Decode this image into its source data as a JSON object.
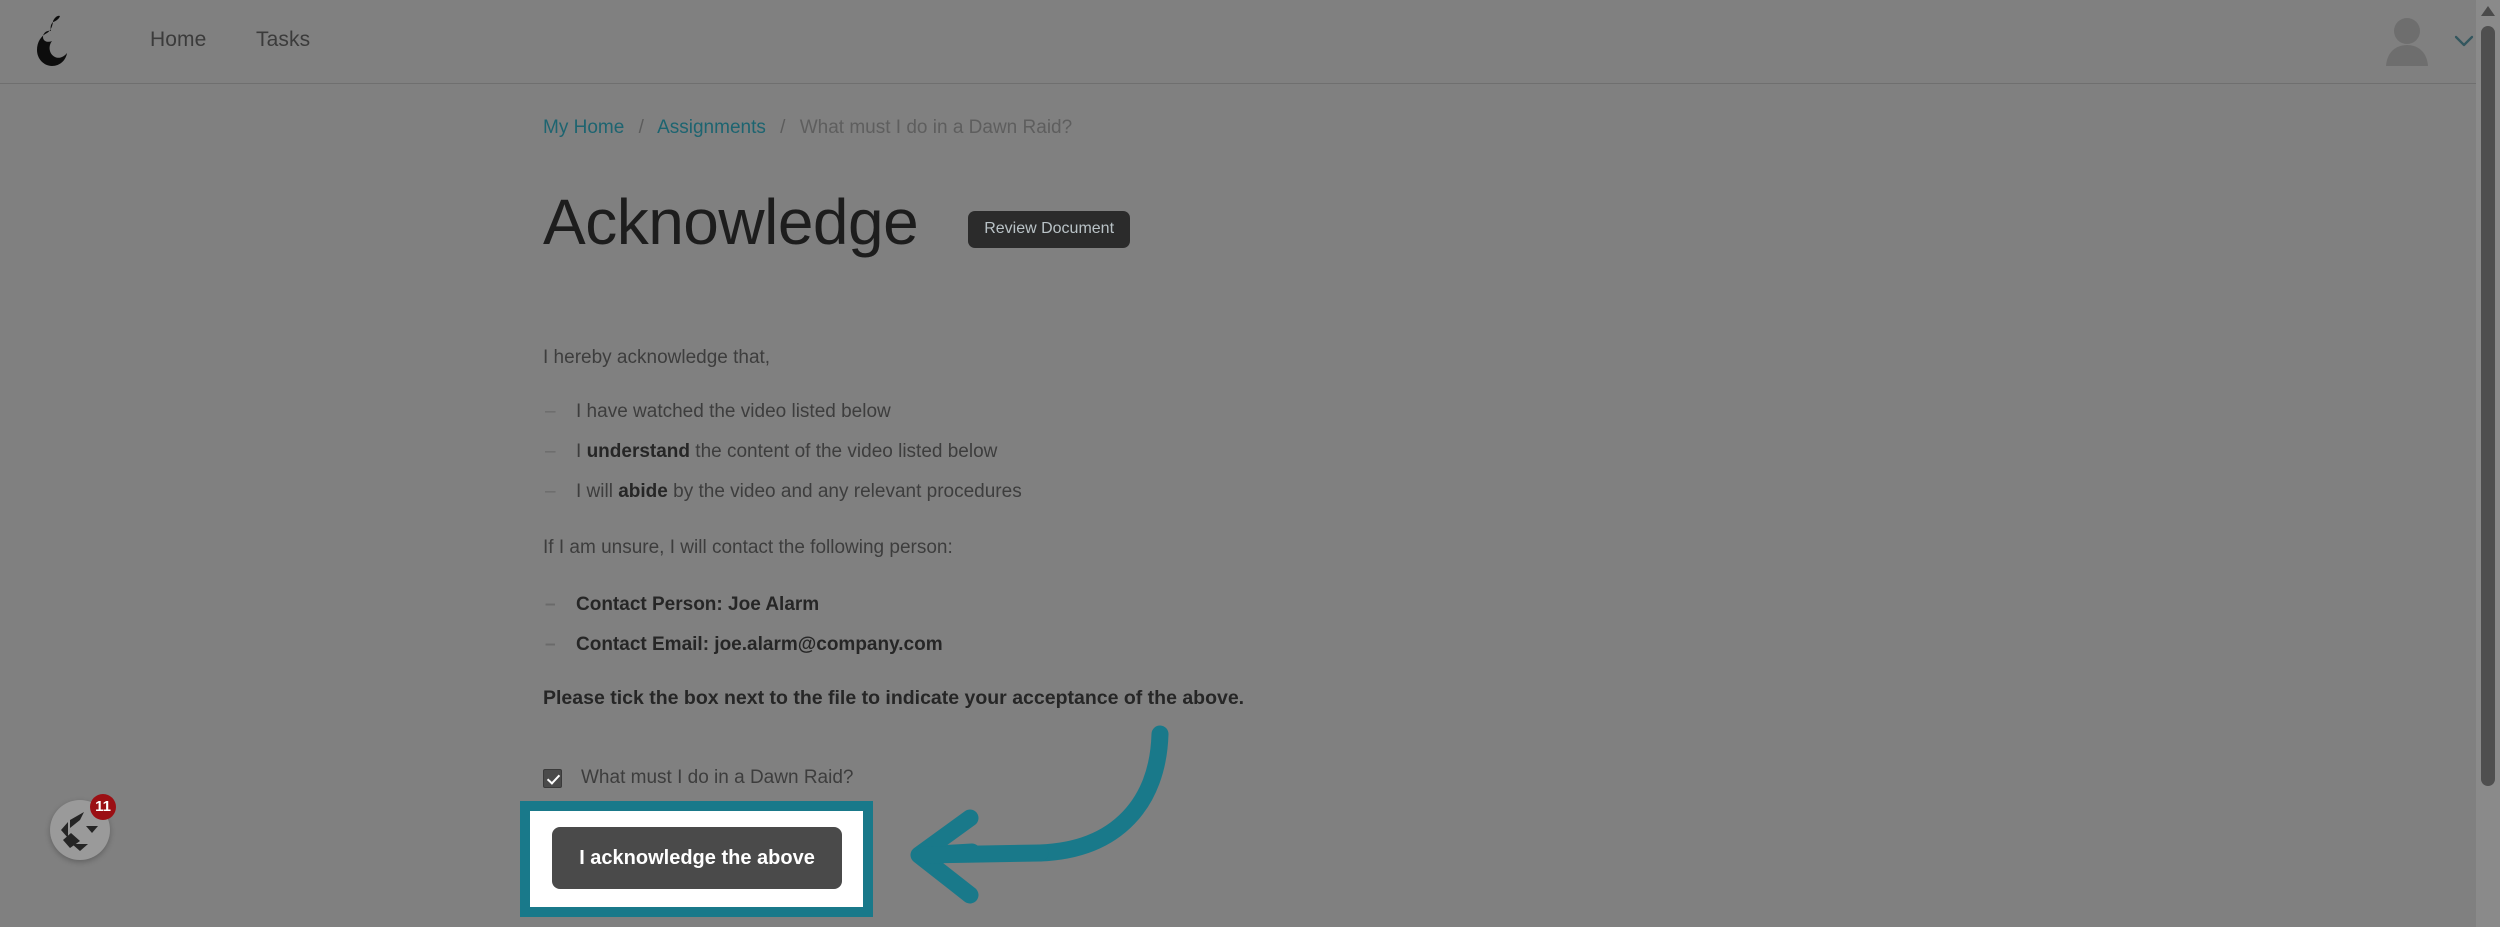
{
  "header": {
    "logo_icon": "pear-logo-icon",
    "nav": [
      {
        "label": "Home"
      },
      {
        "label": "Tasks"
      }
    ],
    "avatar_icon": "avatar-icon",
    "user_menu_icon": "chevron-down-icon"
  },
  "breadcrumb": {
    "items": [
      {
        "label": "My Home",
        "link": true
      },
      {
        "label": "Assignments",
        "link": true
      },
      {
        "label": "What must I do in a Dawn Raid?",
        "link": false
      }
    ],
    "separator": "/"
  },
  "main": {
    "title": "Acknowledge",
    "review_document_label": "Review Document",
    "intro_text": "I hereby acknowledge that,",
    "acknowledgement_items": [
      {
        "prefix": "I have watched the video listed below",
        "bold": "",
        "suffix": ""
      },
      {
        "prefix": "I ",
        "bold": "understand",
        "suffix": " the content of the video listed below"
      },
      {
        "prefix": "I will ",
        "bold": "abide",
        "suffix": " by the video and any relevant procedures"
      }
    ],
    "contact_intro": "If I am unsure, I will contact the following person:",
    "contact_items": [
      {
        "label": "Contact Person: Joe Alarm"
      },
      {
        "label": "Contact Email: joe.alarm@company.com"
      }
    ],
    "tick_instruction": "Please tick the box next to the file to indicate your acceptance of the above.",
    "file_row": {
      "checkbox_checked": true,
      "label": "What must I do in a Dawn Raid?"
    },
    "acknowledge_button_label": "I acknowledge the above"
  },
  "chat_widget": {
    "icon": "chat-logo-icon",
    "badge_count": "11"
  },
  "annotation": {
    "arrow_icon": "curved-left-arrow-icon",
    "highlight_color": "#19798a"
  },
  "colors": {
    "overlay_background": "#808080",
    "accent_teal": "#19798a",
    "link_teal": "#1d6470",
    "dark_button": "#2b2b2b",
    "ack_button": "#4a4a4a",
    "badge_red": "#9b0f14"
  }
}
